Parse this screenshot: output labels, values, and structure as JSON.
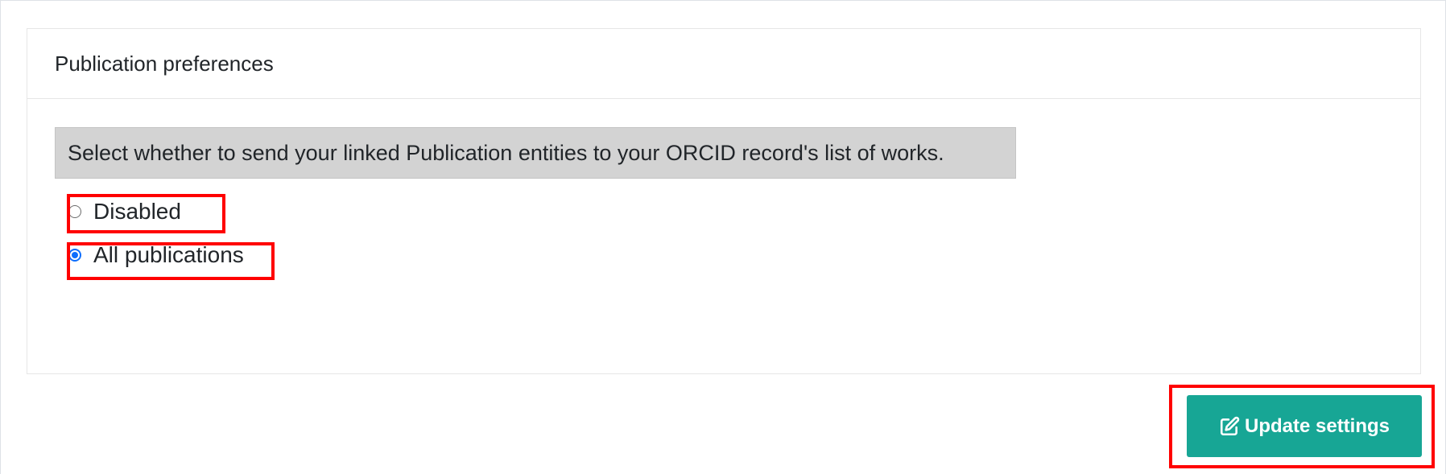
{
  "card": {
    "title": "Publication preferences",
    "help_text": "Select whether to send your linked Publication entities to your ORCID record's list of works."
  },
  "options": [
    {
      "label": "Disabled",
      "checked": false
    },
    {
      "label": "All publications",
      "checked": true
    }
  ],
  "button": {
    "label": "Update settings",
    "icon": "edit-icon"
  },
  "colors": {
    "button_bg": "#17a695",
    "radio_checked": "#0d6efd",
    "highlight": "#ff0000",
    "help_bg": "#d3d3d3"
  }
}
